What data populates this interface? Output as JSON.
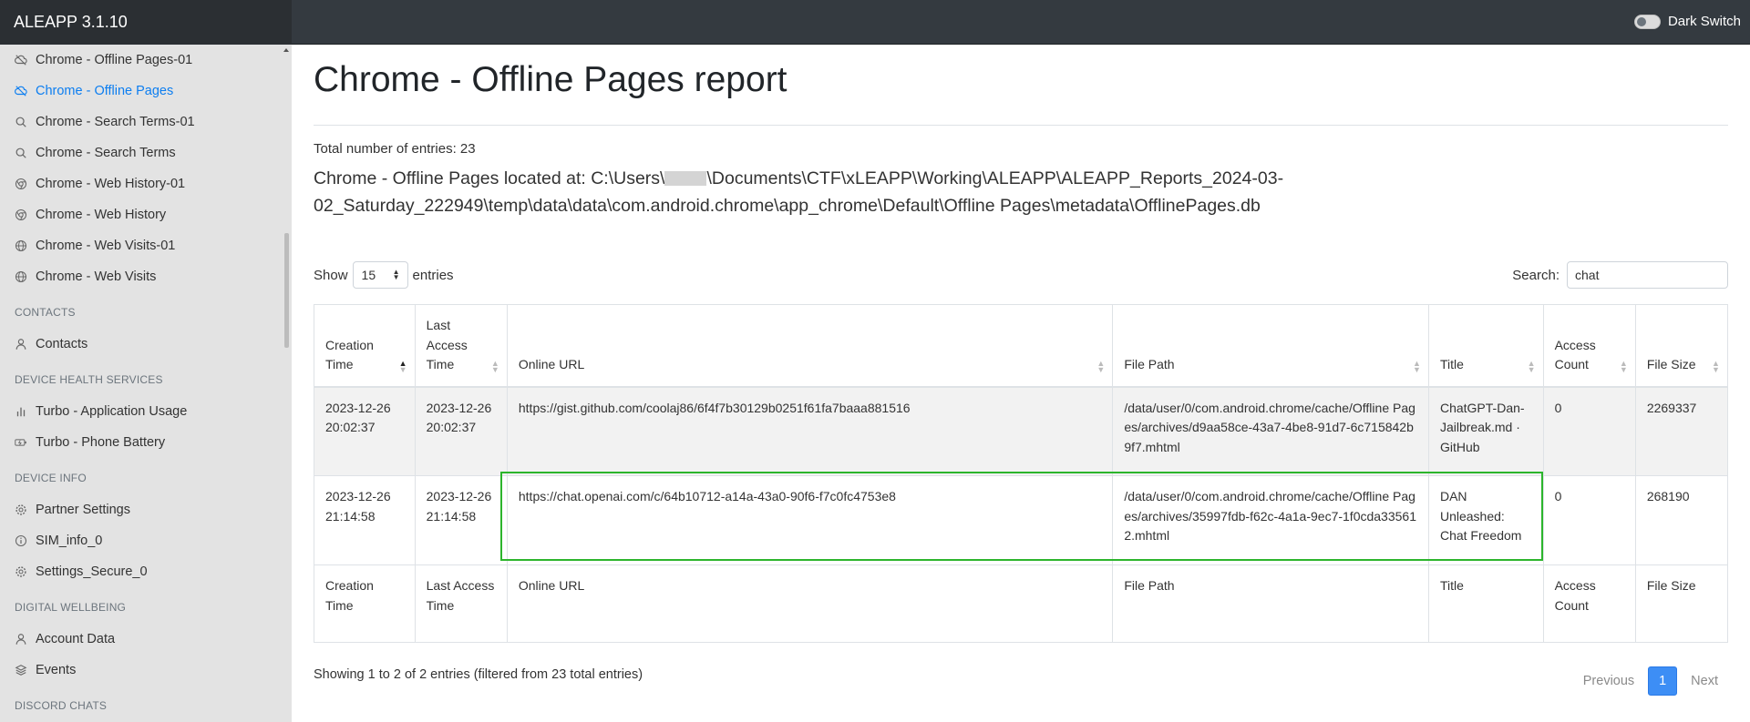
{
  "app": {
    "title": "ALEAPP 3.1.10",
    "dark_switch_label": "Dark Switch"
  },
  "sidebar": {
    "items": [
      {
        "label": "Chrome - Offline Pages-01",
        "icon": "cloud-off-icon"
      },
      {
        "label": "Chrome - Offline Pages",
        "icon": "cloud-off-icon",
        "active": true
      },
      {
        "label": "Chrome - Search Terms-01",
        "icon": "search-icon"
      },
      {
        "label": "Chrome - Search Terms",
        "icon": "search-icon"
      },
      {
        "label": "Chrome - Web History-01",
        "icon": "chrome-icon"
      },
      {
        "label": "Chrome - Web History",
        "icon": "chrome-icon"
      },
      {
        "label": "Chrome - Web Visits-01",
        "icon": "globe-icon"
      },
      {
        "label": "Chrome - Web Visits",
        "icon": "globe-icon"
      }
    ],
    "sections": [
      {
        "header": "CONTACTS",
        "items": [
          {
            "label": "Contacts",
            "icon": "user-icon"
          }
        ]
      },
      {
        "header": "DEVICE HEALTH SERVICES",
        "items": [
          {
            "label": "Turbo - Application Usage",
            "icon": "bar-chart-icon"
          },
          {
            "label": "Turbo - Phone Battery",
            "icon": "battery-charging-icon"
          }
        ]
      },
      {
        "header": "DEVICE INFO",
        "items": [
          {
            "label": "Partner Settings",
            "icon": "settings-icon"
          },
          {
            "label": "SIM_info_0",
            "icon": "info-icon"
          },
          {
            "label": "Settings_Secure_0",
            "icon": "settings-icon"
          }
        ]
      },
      {
        "header": "DIGITAL WELLBEING",
        "items": [
          {
            "label": "Account Data",
            "icon": "user-icon"
          },
          {
            "label": "Events",
            "icon": "layers-icon"
          }
        ]
      },
      {
        "header": "DISCORD CHATS",
        "items": []
      }
    ]
  },
  "report": {
    "title": "Chrome - Offline Pages report",
    "total_entries": "Total number of entries: 23",
    "location_prefix": "Chrome - Offline Pages located at: C:\\Users\\",
    "location_suffix": "\\Documents\\CTF\\xLEAPP\\Working\\ALEAPP\\ALEAPP_Reports_2024-03-02_Saturday_222949\\temp\\data\\data\\com.android.chrome\\app_chrome\\Default\\Offline Pages\\metadata\\OfflinePages.db"
  },
  "table_controls": {
    "show_label": "Show",
    "entries_label": "entries",
    "page_length": "15",
    "search_label": "Search:",
    "search_value": "chat"
  },
  "table": {
    "columns": [
      "Creation Time",
      "Last Access Time",
      "Online URL",
      "File Path",
      "Title",
      "Access Count",
      "File Size"
    ],
    "rows": [
      [
        "2023-12-26 20:02:37",
        "2023-12-26 20:02:37",
        "https://gist.github.com/coolaj86/6f4f7b30129b0251f61fa7baaa881516",
        "/data/user/0/com.android.chrome/cache/Offline Pages/archives/d9aa58ce-43a7-4be8-91d7-6c715842b9f7.mhtml",
        "ChatGPT-Dan-Jailbreak.md · GitHub",
        "0",
        "2269337"
      ],
      [
        "2023-12-26 21:14:58",
        "2023-12-26 21:14:58",
        "https://chat.openai.com/c/64b10712-a14a-43a0-90f6-f7c0fc4753e8",
        "/data/user/0/com.android.chrome/cache/Offline Pages/archives/35997fdb-f62c-4a1a-9ec7-1f0cda335612.mhtml",
        "DAN Unleashed: Chat Freedom",
        "0",
        "268190"
      ]
    ]
  },
  "footer": {
    "info": "Showing 1 to 2 of 2 entries (filtered from 23 total entries)",
    "previous": "Previous",
    "current_page": "1",
    "next": "Next"
  },
  "colors": {
    "highlight": "#2cb52c",
    "accent": "#0d7ef0",
    "topbar": "#343a40"
  }
}
